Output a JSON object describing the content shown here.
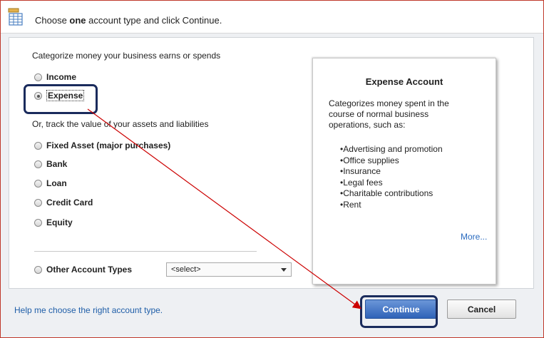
{
  "header": {
    "instruction_before": "Choose ",
    "instruction_bold": "one",
    "instruction_after": " account type and click Continue.",
    "icon": "account-list-icon"
  },
  "categorize_label": "Categorize money your business earns or spends",
  "track_label": "Or, track the value of your assets and liabilities",
  "account_types": [
    {
      "label": "Income",
      "selected": false
    },
    {
      "label": "Expense",
      "selected": true
    },
    {
      "label": "Fixed Asset (major purchases)",
      "selected": false
    },
    {
      "label": "Bank",
      "selected": false
    },
    {
      "label": "Loan",
      "selected": false
    },
    {
      "label": "Credit Card",
      "selected": false
    },
    {
      "label": "Equity",
      "selected": false
    },
    {
      "label": "Other Account Types",
      "selected": false
    }
  ],
  "other_select": {
    "value": "<select>"
  },
  "info_panel": {
    "title": "Expense Account",
    "description": "Categorizes money spent in the course of normal business operations, such as:",
    "items": [
      "Advertising and promotion",
      "Office supplies",
      "Insurance",
      "Legal fees",
      "Charitable contributions",
      "Rent"
    ],
    "more_link": "More..."
  },
  "footer": {
    "help_link": "Help me choose the right account type.",
    "continue_label": "Continue",
    "cancel_label": "Cancel"
  },
  "colors": {
    "annotation_box": "#1a2b5c",
    "annotation_arrow": "#cc0000",
    "continue_button": "#2f63b8",
    "link": "#1f5ea8"
  }
}
